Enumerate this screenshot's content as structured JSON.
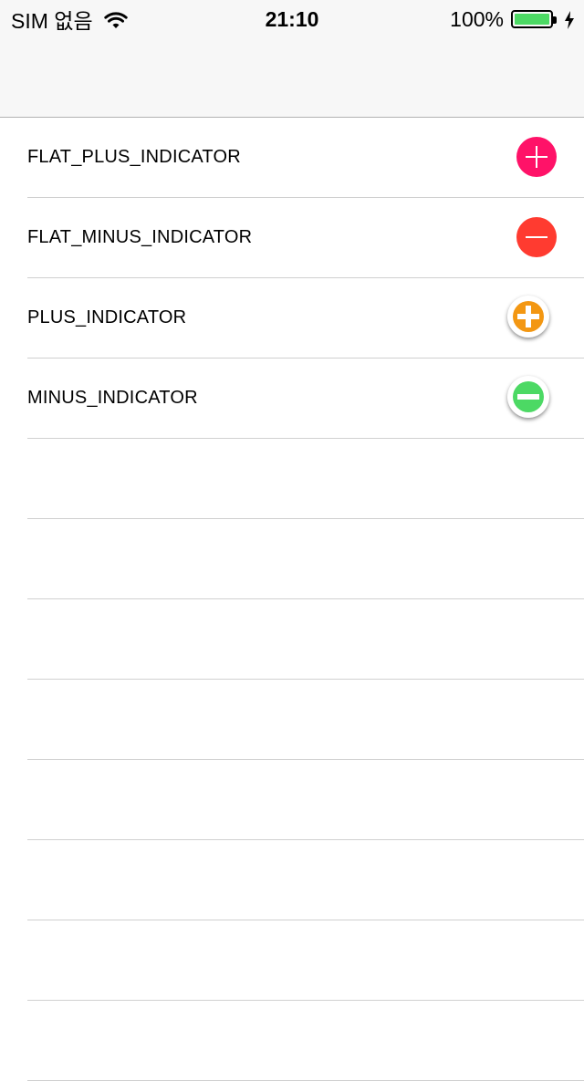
{
  "status": {
    "carrier": "SIM 없음",
    "time": "21:10",
    "battery": "100%",
    "icons": [
      "wifi-icon",
      "battery-icon",
      "charging-bolt-icon"
    ],
    "battery_color": "#4cd964"
  },
  "list": {
    "rows": [
      {
        "label": "FLAT_PLUS_INDICATOR",
        "indicator": "flat-plus-icon",
        "color": "#ff1268"
      },
      {
        "label": "FLAT_MINUS_INDICATOR",
        "indicator": "flat-minus-icon",
        "color": "#ff3b30"
      },
      {
        "label": "PLUS_INDICATOR",
        "indicator": "plus-indicator-icon",
        "color": "#f39712"
      },
      {
        "label": "MINUS_INDICATOR",
        "indicator": "minus-indicator-icon",
        "color": "#4cd964"
      }
    ]
  }
}
